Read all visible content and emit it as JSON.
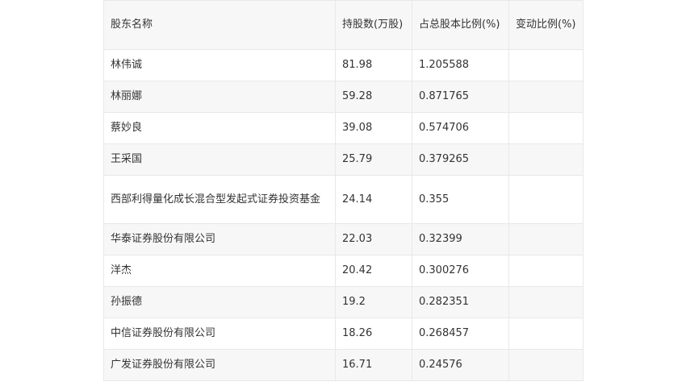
{
  "table": {
    "headers": [
      "股东名称",
      "持股数(万股)",
      "占总股本比例(%)",
      "变动比例(%)"
    ],
    "rows": [
      [
        "林伟诚",
        "81.98",
        "1.205588",
        ""
      ],
      [
        "林丽娜",
        "59.28",
        "0.871765",
        ""
      ],
      [
        "蔡妙良",
        "39.08",
        "0.574706",
        ""
      ],
      [
        "王采国",
        "25.79",
        "0.379265",
        ""
      ],
      [
        "西部利得量化成长混合型发起式证券投资基金",
        "24.14",
        "0.355",
        ""
      ],
      [
        "华泰证券股份有限公司",
        "22.03",
        "0.32399",
        ""
      ],
      [
        "洋杰",
        "20.42",
        "0.300276",
        ""
      ],
      [
        "孙振德",
        "19.2",
        "0.282351",
        ""
      ],
      [
        "中信证券股份有限公司",
        "18.26",
        "0.268457",
        ""
      ],
      [
        "广发证券股份有限公司",
        "16.71",
        "0.24576",
        ""
      ]
    ]
  }
}
